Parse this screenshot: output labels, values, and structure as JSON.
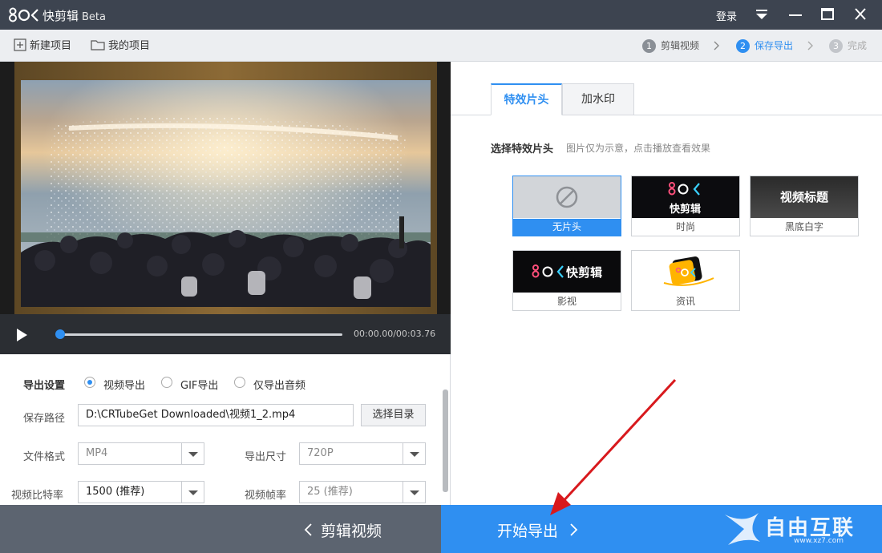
{
  "titlebar": {
    "logo": "8OK",
    "app_name": "快剪辑",
    "beta": "Beta",
    "login": "登录"
  },
  "toolbar": {
    "new_project": "新建项目",
    "my_projects": "我的项目",
    "steps": [
      {
        "num": "1",
        "label": "剪辑视频"
      },
      {
        "num": "2",
        "label": "保存导出"
      },
      {
        "num": "3",
        "label": "完成"
      }
    ]
  },
  "player": {
    "timecode": "00:00.00/00:03.76",
    "progress": 0.0
  },
  "export": {
    "section_label": "导出设置",
    "options": [
      "视频导出",
      "GIF导出",
      "仅导出音频"
    ],
    "selected": "视频导出",
    "save_path_label": "保存路径",
    "save_path": "D:\\CRTubeGet Downloaded\\视频1_2.mp4",
    "browse_button": "选择目录",
    "format_label": "文件格式",
    "format_value": "MP4",
    "size_label": "导出尺寸",
    "size_value": "720P",
    "bitrate_label": "视频比特率",
    "bitrate_value": "1500 (推荐)",
    "framerate_label": "视频帧率",
    "framerate_value": "25 (推荐)"
  },
  "right": {
    "tabs": [
      "特效片头",
      "加水印"
    ],
    "section_title": "选择特效片头",
    "section_hint": "图片仅为示意，点击播放查看效果",
    "cards": [
      {
        "label": "无片头"
      },
      {
        "label": "时尚",
        "thumb_text": "快剪辑"
      },
      {
        "label": "黑底白字",
        "thumb_text": "视频标题"
      },
      {
        "label": "影视",
        "thumb_text": "快剪辑"
      },
      {
        "label": "资讯"
      }
    ]
  },
  "bottom": {
    "back": "剪辑视频",
    "export": "开始导出"
  },
  "watermark": {
    "text": "自由互联",
    "url": "www.xz7.com"
  },
  "colors": {
    "accent": "#2f8ff1",
    "titlebar": "#3d4450",
    "back_button": "#5c6470",
    "annotation_arrow": "#d8191d"
  }
}
